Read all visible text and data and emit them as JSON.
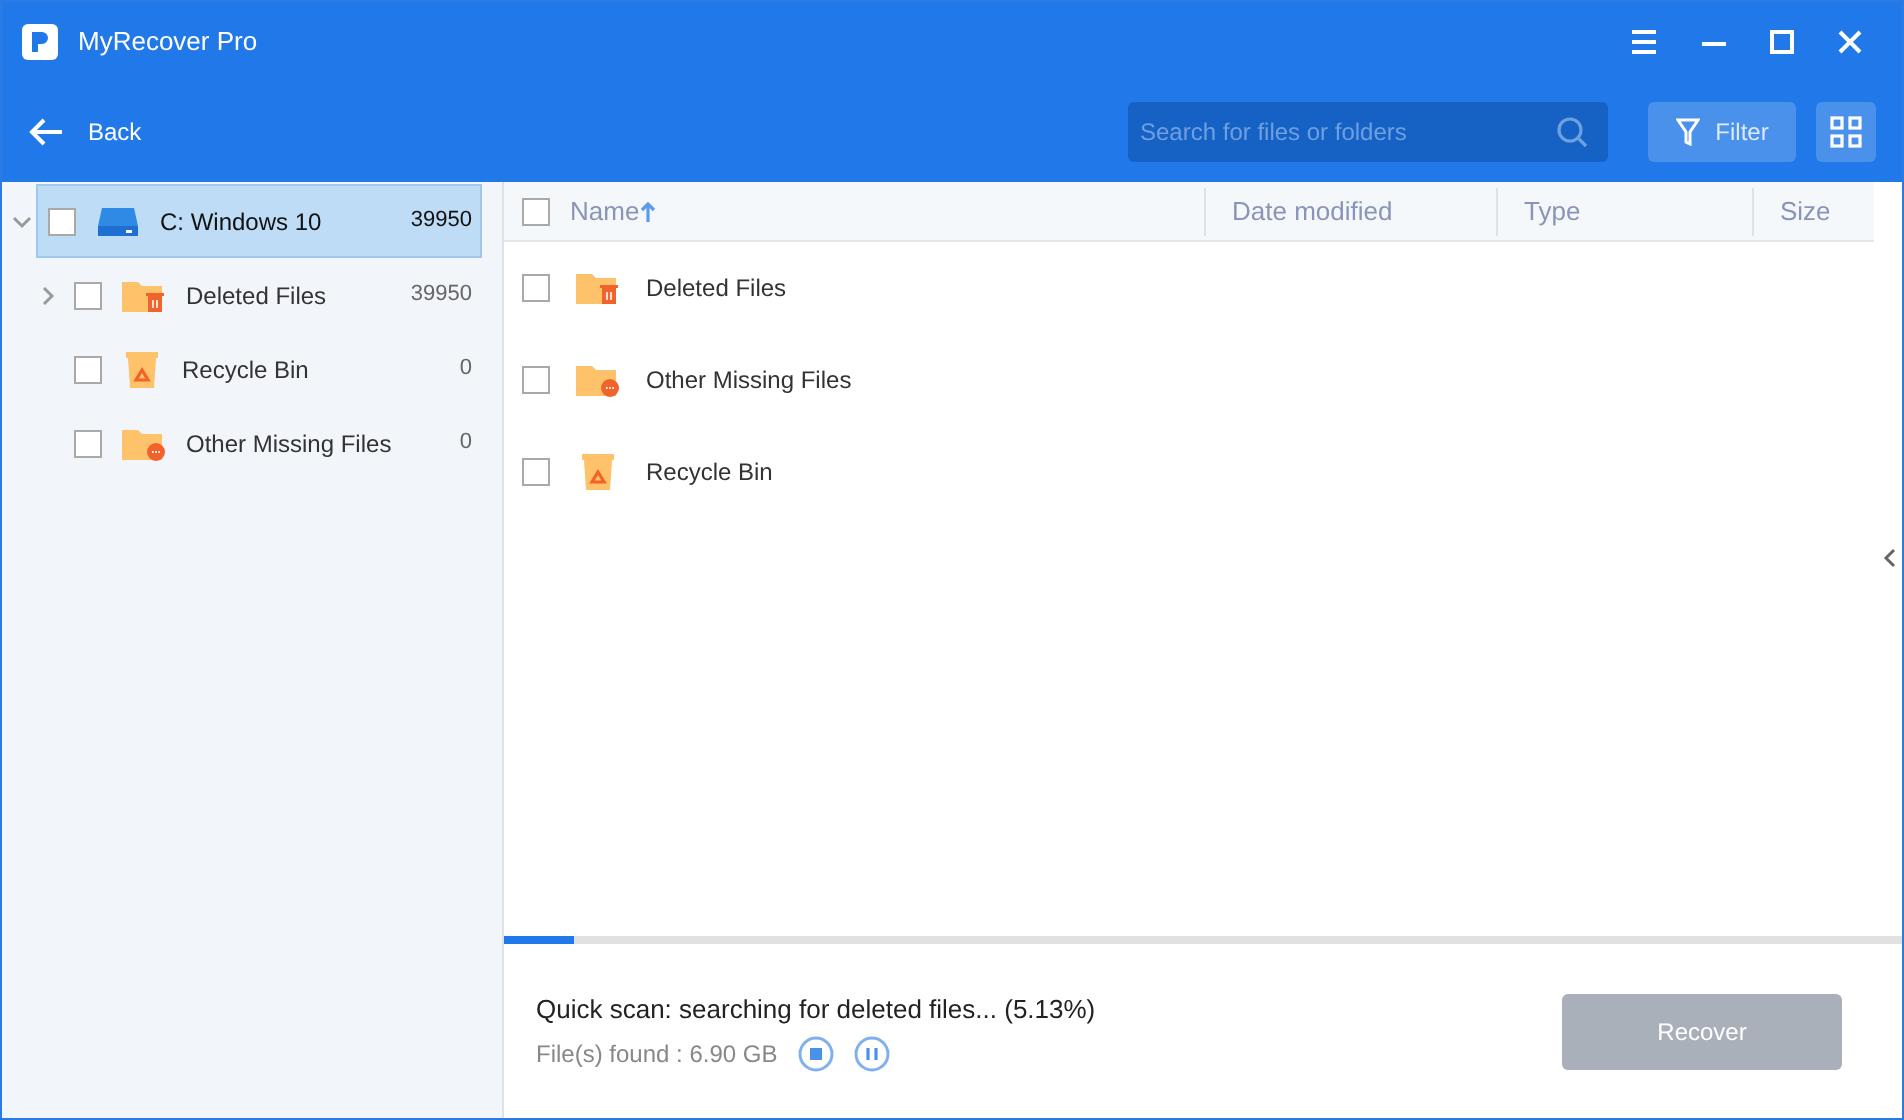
{
  "window": {
    "title": "MyRecover Pro"
  },
  "toolbar": {
    "back": "Back",
    "search": {
      "placeholder": "Search for files or folders"
    },
    "filter": "Filter"
  },
  "tree": [
    {
      "label": "C: Windows 10",
      "count": "39950",
      "kind": "drive",
      "selected": true,
      "checked": false,
      "expanded": true,
      "children": [
        {
          "label": "Deleted Files",
          "count": "39950",
          "kind": "deleted",
          "selected": false,
          "checked": false,
          "expanded": false,
          "has_children": true
        },
        {
          "label": "Recycle Bin",
          "count": "0",
          "kind": "recycle",
          "selected": false,
          "checked": false,
          "has_children": false
        },
        {
          "label": "Other Missing Files",
          "count": "0",
          "kind": "missing",
          "selected": false,
          "checked": false,
          "has_children": false
        }
      ]
    }
  ],
  "table": {
    "all_checked": false,
    "columns": [
      "Name",
      "Date modified",
      "Type",
      "Size"
    ],
    "sort_ascending": true,
    "rows": [
      {
        "name": "Deleted Files",
        "kind": "deleted",
        "checked": false
      },
      {
        "name": "Other Missing Files",
        "kind": "missing",
        "checked": false
      },
      {
        "name": "Recycle Bin",
        "kind": "recycle",
        "checked": false
      }
    ]
  },
  "scan": {
    "level": 0.05,
    "status": "Quick scan: searching for deleted files... (5.13%)",
    "found": "File(s) found : 6.90 GB"
  },
  "recover_button": {
    "label": "Recover",
    "disabled": true
  }
}
